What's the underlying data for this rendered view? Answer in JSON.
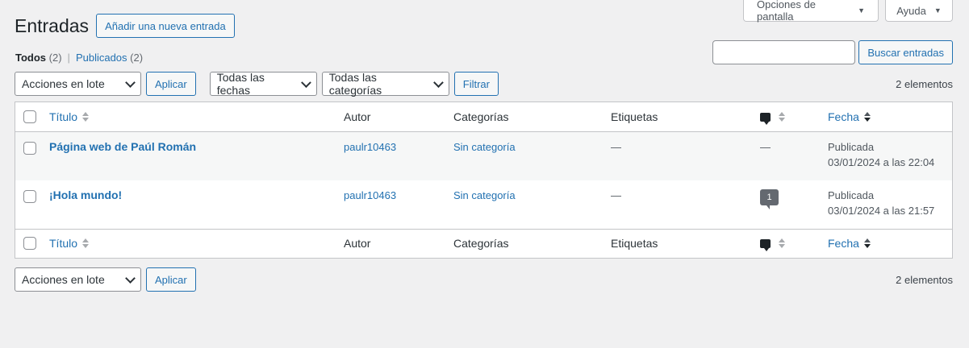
{
  "screen_meta": {
    "options_label": "Opciones de pantalla",
    "help_label": "Ayuda"
  },
  "header": {
    "title": "Entradas",
    "add_new_label": "Añadir una nueva entrada"
  },
  "views": {
    "all_label": "Todos",
    "all_count": "(2)",
    "separator": "|",
    "published_label": "Publicados",
    "published_count": "(2)"
  },
  "search": {
    "button_label": "Buscar entradas",
    "value": ""
  },
  "tablenav_top": {
    "bulk_actions": "Acciones en lote",
    "apply_label": "Aplicar",
    "dates_filter": "Todas las fechas",
    "categories_filter": "Todas las categorías",
    "filter_label": "Filtrar",
    "count": "2 elementos"
  },
  "tablenav_bottom": {
    "bulk_actions": "Acciones en lote",
    "apply_label": "Aplicar",
    "count": "2 elementos"
  },
  "columns": {
    "title": "Título",
    "author": "Autor",
    "categories": "Categorías",
    "tags": "Etiquetas",
    "date": "Fecha"
  },
  "rows": [
    {
      "title": "Página web de Paúl Román",
      "author": "paulr10463",
      "category": "Sin categoría",
      "tags": "—",
      "comments": "—",
      "status": "Publicada",
      "date": "03/01/2024 a las 22:04"
    },
    {
      "title": "¡Hola mundo!",
      "author": "paulr10463",
      "category": "Sin categoría",
      "tags": "—",
      "comments": "1",
      "status": "Publicada",
      "date": "03/01/2024 a las 21:57"
    }
  ],
  "colors": {
    "link": "#2271b1",
    "background": "#f0f0f1",
    "border": "#c3c4c7"
  }
}
